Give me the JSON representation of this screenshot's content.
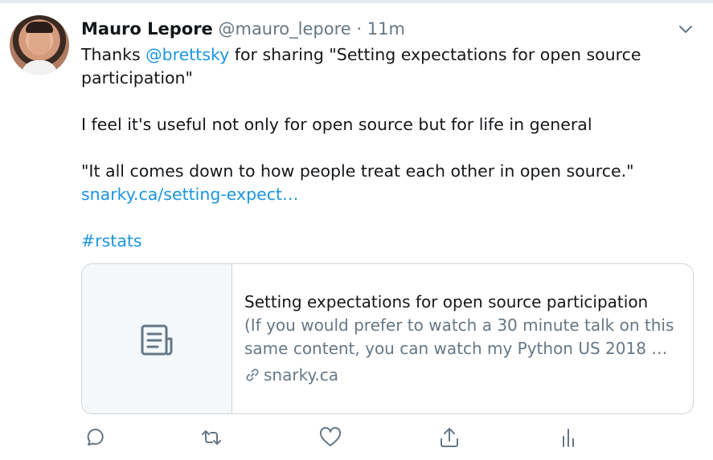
{
  "tweet": {
    "author_name": "Mauro Lepore",
    "author_handle": "@mauro_lepore",
    "separator": "·",
    "time": "11m",
    "line1_prefix": "Thanks ",
    "mention": "@brettsky",
    "line1_suffix": " for sharing \"Setting expectations for open source participation\"",
    "paragraph2": "I feel it's useful not only for open source but for life in general",
    "paragraph3": "\"It all comes down to how people treat each other in open source.\"",
    "url": "snarky.ca/setting-expect…",
    "hashtag": "#rstats"
  },
  "card": {
    "title": "Setting expectations for open source participation",
    "description": "(If you would prefer to watch a 30 minute talk on this same content, you can watch my Python US 2018 …",
    "domain": "snarky.ca",
    "thumbnail_icon": "article-icon"
  },
  "actions": {
    "icons": [
      "reply-icon",
      "retweet-icon",
      "like-icon",
      "share-icon",
      "analytics-icon"
    ]
  },
  "colors": {
    "link": "#1b95e0",
    "text": "#14171a",
    "secondary": "#657786",
    "border": "#ccd6dd"
  }
}
